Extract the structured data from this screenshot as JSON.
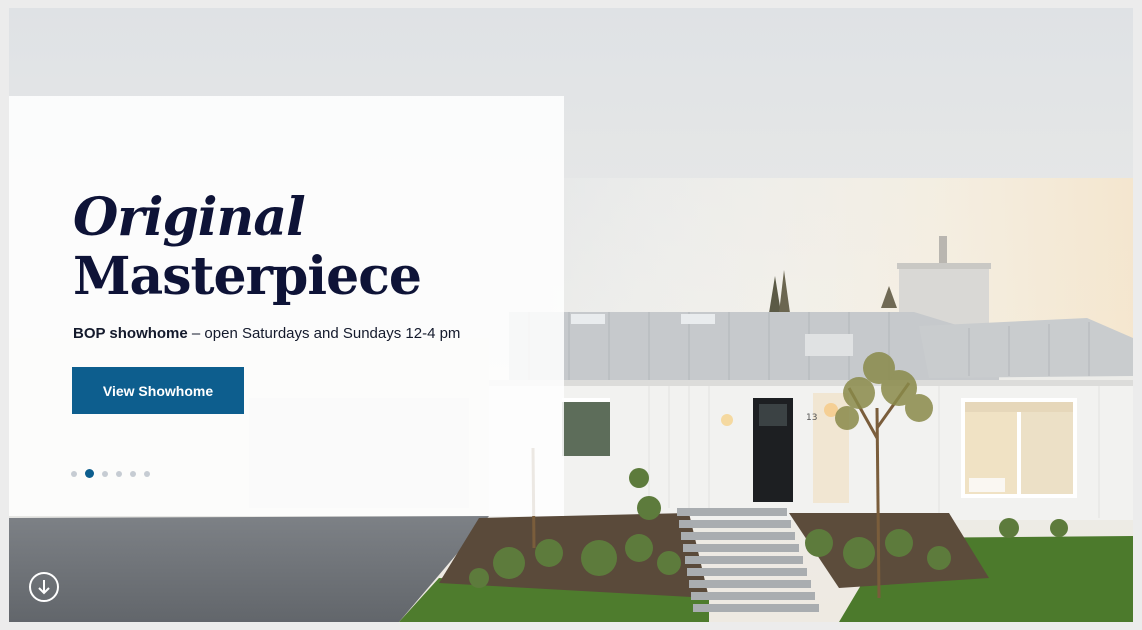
{
  "hero": {
    "headline_line1": "Original",
    "headline_line2": "Masterpiece",
    "subtitle_bold": "BOP showhome",
    "subtitle_rest": " – open Saturdays and Sundays 12-4 pm",
    "cta_label": "View Showhome",
    "house_number": "13"
  },
  "carousel": {
    "slide_count": 6,
    "active_index": 1
  },
  "icons": {
    "scroll_down": "arrow-down-circle-icon"
  },
  "colors": {
    "headline": "#0e1337",
    "accent": "#0d5e8e",
    "dot_inactive": "#c6ccd3"
  }
}
